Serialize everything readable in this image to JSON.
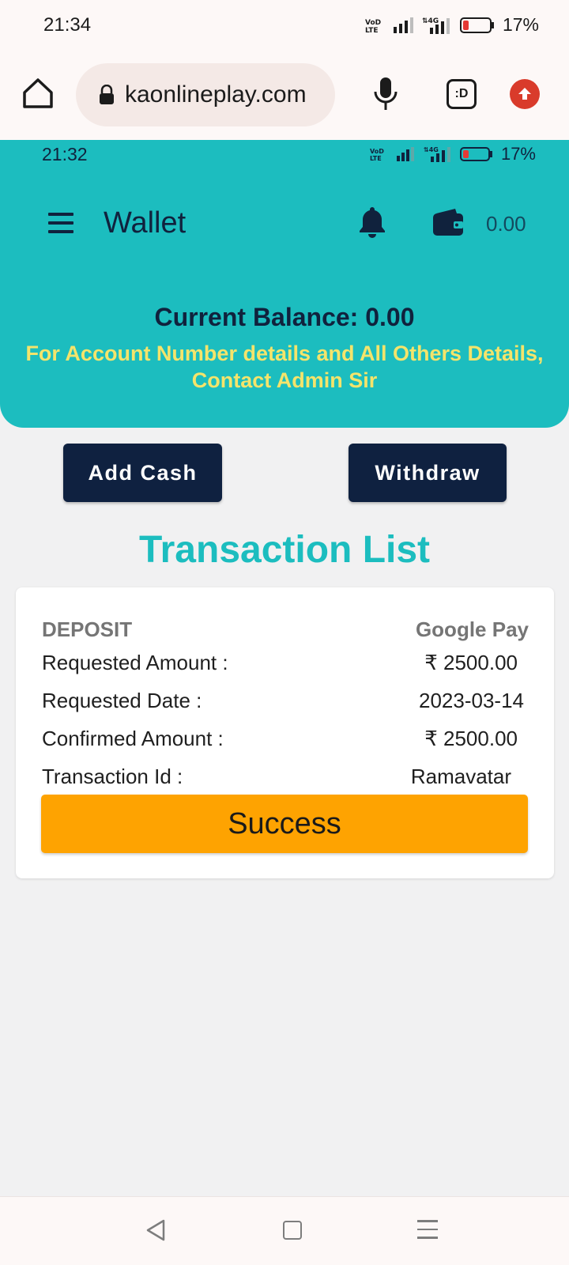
{
  "system_status": {
    "time": "21:34",
    "network": "VoLTE",
    "signal_label": "4G",
    "battery": "17%"
  },
  "browser": {
    "url": "kaonlineplay.com",
    "tabs_label": ":D"
  },
  "app_status": {
    "time": "21:32",
    "battery": "17%"
  },
  "header": {
    "title": "Wallet",
    "wallet_amount": "0.00"
  },
  "balance": {
    "line": "Current Balance: 0.00",
    "notice": "For Account Number details and All Others Details, Contact Admin Sir"
  },
  "actions": {
    "add_cash": "Add Cash",
    "withdraw": "Withdraw"
  },
  "transactions": {
    "title": "Transaction List",
    "items": [
      {
        "type": "DEPOSIT",
        "method": "Google Pay",
        "requested_amount_label": "Requested Amount :",
        "requested_amount": "₹ 2500.00",
        "requested_date_label": "Requested Date :",
        "requested_date": "2023-03-14",
        "confirmed_amount_label": "Confirmed Amount :",
        "confirmed_amount": "₹ 2500.00",
        "transaction_id_label": "Transaction Id :",
        "transaction_id": "Ramavatar",
        "status": "Success"
      }
    ]
  },
  "colors": {
    "teal": "#1cbdbf",
    "navy": "#0f2140",
    "notice_yellow": "#f4e46b",
    "success_orange": "#fea301"
  }
}
